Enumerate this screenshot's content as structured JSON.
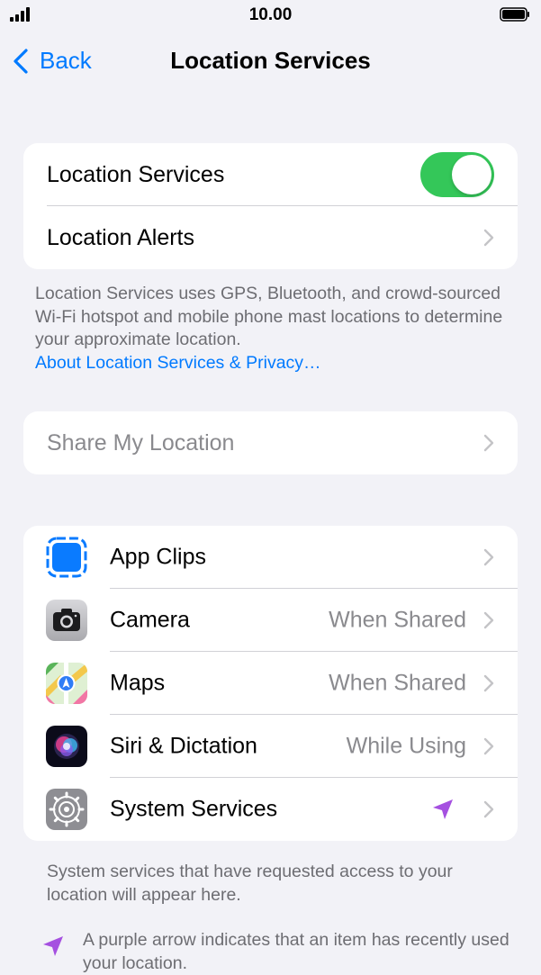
{
  "status_bar": {
    "time": "10.00"
  },
  "nav": {
    "back_label": "Back",
    "title": "Location Services"
  },
  "section1": {
    "location_services": {
      "label": "Location Services",
      "enabled": true
    },
    "location_alerts": {
      "label": "Location Alerts"
    }
  },
  "footer1": {
    "text": "Location Services uses GPS, Bluetooth, and crowd-sourced Wi-Fi hotspot and mobile phone mast locations to determine your approximate location.",
    "link": "About Location Services & Privacy…"
  },
  "share": {
    "label": "Share My Location"
  },
  "apps": [
    {
      "label": "App Clips",
      "value": "",
      "icon": "app-clips-icon"
    },
    {
      "label": "Camera",
      "value": "When Shared",
      "icon": "camera-icon"
    },
    {
      "label": "Maps",
      "value": "When Shared",
      "icon": "maps-icon"
    },
    {
      "label": "Siri & Dictation",
      "value": "While Using",
      "icon": "siri-icon"
    },
    {
      "label": "System Services",
      "value": "",
      "icon": "system-services-icon",
      "indicator": "purple-arrow-icon"
    }
  ],
  "footer2": {
    "text": "System services that have requested access to your location will appear here.",
    "arrow_note": "A purple arrow indicates that an item has recently used your location."
  },
  "colors": {
    "accent": "#007aff",
    "toggle_on": "#34c759",
    "purple_arrow": "#a550e0"
  }
}
